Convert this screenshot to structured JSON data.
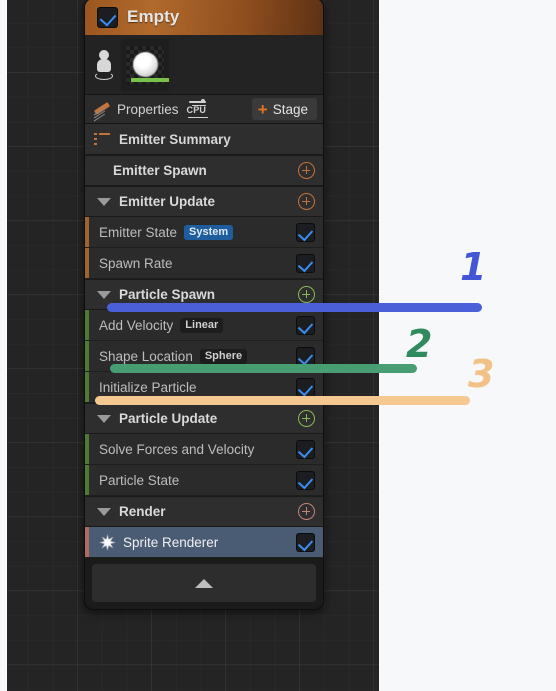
{
  "node": {
    "header": {
      "title": "Empty",
      "checkbox_checked": true,
      "color": "#a05c22"
    },
    "thumbnail": {
      "pawn_icon": "person-icon",
      "preview_icon": "sphere-preview",
      "bar_color": "#77c24a"
    },
    "toolbar": {
      "pencil_icon": "pencil-icon",
      "properties_label": "Properties",
      "cpu_icon": "cpu-icon",
      "stage_button": {
        "plus_icon": "plus-icon",
        "label": "Stage",
        "accent": "#e2731e"
      }
    },
    "summary": {
      "icon": "list-icon",
      "label": "Emitter Summary"
    },
    "sections": [
      {
        "type": "group",
        "name": "Emitter Spawn",
        "label": "Emitter Spawn",
        "has_caret": false,
        "add_icon": "plus-circle-icon",
        "add_color": "#c4723a",
        "accent": "#a0622f",
        "modules": []
      },
      {
        "type": "group",
        "name": "Emitter Update",
        "label": "Emitter Update",
        "has_caret": true,
        "add_icon": "plus-circle-icon",
        "add_color": "#c4723a",
        "accent": "#a0622f",
        "modules": [
          {
            "label": "Emitter State",
            "pill": "System",
            "pill_style": "blue",
            "checked": true
          },
          {
            "label": "Spawn Rate",
            "pill": "",
            "pill_style": "",
            "checked": true
          }
        ]
      },
      {
        "type": "group",
        "name": "Particle Spawn",
        "label": "Particle Spawn",
        "has_caret": true,
        "add_icon": "plus-circle-icon",
        "add_color": "#86bb55",
        "accent": "#4f7a33",
        "modules": [
          {
            "label": "Add Velocity",
            "pill": "Linear",
            "pill_style": "dark",
            "checked": true
          },
          {
            "label": "Shape Location",
            "pill": "Sphere",
            "pill_style": "dark",
            "checked": true
          },
          {
            "label": "Initialize Particle",
            "pill": "",
            "pill_style": "",
            "checked": true
          }
        ]
      },
      {
        "type": "group",
        "name": "Particle Update",
        "label": "Particle Update",
        "has_caret": true,
        "add_icon": "plus-circle-icon",
        "add_color": "#86bb55",
        "accent": "#4f7a33",
        "modules": [
          {
            "label": "Solve Forces and Velocity",
            "pill": "",
            "pill_style": "",
            "checked": true
          },
          {
            "label": "Particle State",
            "pill": "",
            "pill_style": "",
            "checked": true
          }
        ]
      },
      {
        "type": "group",
        "name": "Render",
        "label": "Render",
        "has_caret": true,
        "add_icon": "plus-circle-icon",
        "add_color": "#c4847a",
        "accent": "#b06a5e",
        "modules": [
          {
            "label": "Sprite Renderer",
            "pill": "",
            "pill_style": "",
            "checked": true,
            "icon": "star-icon",
            "selected": true
          }
        ]
      }
    ],
    "collapse_bar": {
      "icon": "chevron-up-icon"
    }
  },
  "annotations": [
    {
      "number": "1",
      "color": "#4456d6",
      "line_color": "#4a5fd8"
    },
    {
      "number": "2",
      "color": "#2f8a5e",
      "line_color": "#489e72"
    },
    {
      "number": "3",
      "color": "#f2c188",
      "line_color": "#f5c791"
    }
  ]
}
